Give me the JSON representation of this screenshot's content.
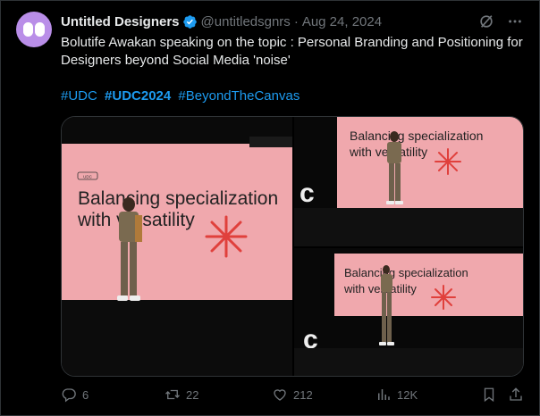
{
  "account": {
    "display_name": "Untitled Designers",
    "handle": "@untitledsgnrs",
    "separator": "·",
    "date": "Aug 24, 2024",
    "verified": true,
    "avatar_bg": "#b98ee8"
  },
  "post": {
    "text": "Bolutife Awakan speaking on the topic : Personal Branding and Positioning for Designers beyond Social Media 'noise'",
    "hashtags": [
      "#UDC",
      "#UDC2024",
      "#BeyondTheCanvas"
    ]
  },
  "media": {
    "slide_title_line1": "Balancing specialization",
    "slide_title_line2": "with versatility",
    "slide_logo": "UDC",
    "images": [
      {
        "name": "speaker-on-stage-wide",
        "icon": "photo"
      },
      {
        "name": "speaker-on-stage-top",
        "icon": "photo"
      },
      {
        "name": "speaker-on-stage-bottom",
        "icon": "photo"
      }
    ]
  },
  "actions": {
    "replies": "6",
    "reposts": "22",
    "likes": "212",
    "views": "12K"
  },
  "colors": {
    "background": "#000000",
    "text": "#e7e9ea",
    "muted": "#71767b",
    "link": "#1d9bf0",
    "verified": "#1d9bf0",
    "slide_pink": "#f3b0b3",
    "slide_red": "#e0403c"
  },
  "icons": {
    "verified": "verified-badge-icon",
    "grok": "grok-icon",
    "more": "more-icon",
    "reply": "reply-icon",
    "repost": "repost-icon",
    "like": "heart-icon",
    "views": "views-icon",
    "bookmark": "bookmark-icon",
    "share": "share-icon"
  }
}
